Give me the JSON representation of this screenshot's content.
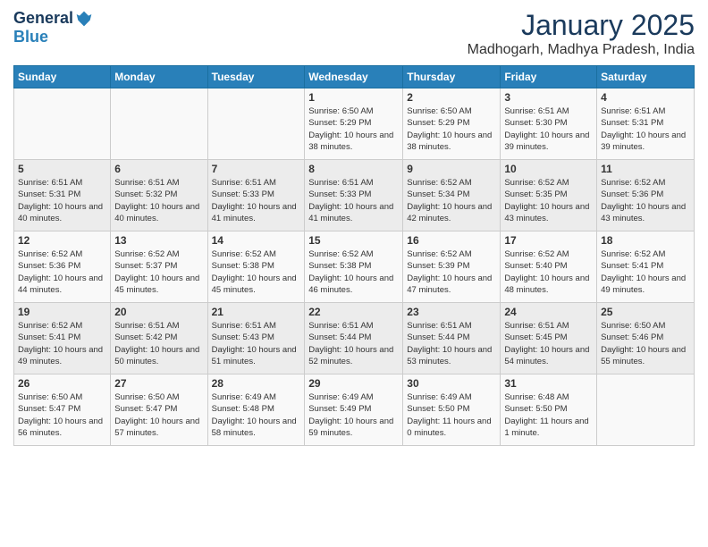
{
  "header": {
    "logo_general": "General",
    "logo_blue": "Blue",
    "month_title": "January 2025",
    "location": "Madhogarh, Madhya Pradesh, India"
  },
  "days_of_week": [
    "Sunday",
    "Monday",
    "Tuesday",
    "Wednesday",
    "Thursday",
    "Friday",
    "Saturday"
  ],
  "weeks": [
    [
      {
        "day": "",
        "sunrise": "",
        "sunset": "",
        "daylight": ""
      },
      {
        "day": "",
        "sunrise": "",
        "sunset": "",
        "daylight": ""
      },
      {
        "day": "",
        "sunrise": "",
        "sunset": "",
        "daylight": ""
      },
      {
        "day": "1",
        "sunrise": "Sunrise: 6:50 AM",
        "sunset": "Sunset: 5:29 PM",
        "daylight": "Daylight: 10 hours and 38 minutes."
      },
      {
        "day": "2",
        "sunrise": "Sunrise: 6:50 AM",
        "sunset": "Sunset: 5:29 PM",
        "daylight": "Daylight: 10 hours and 38 minutes."
      },
      {
        "day": "3",
        "sunrise": "Sunrise: 6:51 AM",
        "sunset": "Sunset: 5:30 PM",
        "daylight": "Daylight: 10 hours and 39 minutes."
      },
      {
        "day": "4",
        "sunrise": "Sunrise: 6:51 AM",
        "sunset": "Sunset: 5:31 PM",
        "daylight": "Daylight: 10 hours and 39 minutes."
      }
    ],
    [
      {
        "day": "5",
        "sunrise": "Sunrise: 6:51 AM",
        "sunset": "Sunset: 5:31 PM",
        "daylight": "Daylight: 10 hours and 40 minutes."
      },
      {
        "day": "6",
        "sunrise": "Sunrise: 6:51 AM",
        "sunset": "Sunset: 5:32 PM",
        "daylight": "Daylight: 10 hours and 40 minutes."
      },
      {
        "day": "7",
        "sunrise": "Sunrise: 6:51 AM",
        "sunset": "Sunset: 5:33 PM",
        "daylight": "Daylight: 10 hours and 41 minutes."
      },
      {
        "day": "8",
        "sunrise": "Sunrise: 6:51 AM",
        "sunset": "Sunset: 5:33 PM",
        "daylight": "Daylight: 10 hours and 41 minutes."
      },
      {
        "day": "9",
        "sunrise": "Sunrise: 6:52 AM",
        "sunset": "Sunset: 5:34 PM",
        "daylight": "Daylight: 10 hours and 42 minutes."
      },
      {
        "day": "10",
        "sunrise": "Sunrise: 6:52 AM",
        "sunset": "Sunset: 5:35 PM",
        "daylight": "Daylight: 10 hours and 43 minutes."
      },
      {
        "day": "11",
        "sunrise": "Sunrise: 6:52 AM",
        "sunset": "Sunset: 5:36 PM",
        "daylight": "Daylight: 10 hours and 43 minutes."
      }
    ],
    [
      {
        "day": "12",
        "sunrise": "Sunrise: 6:52 AM",
        "sunset": "Sunset: 5:36 PM",
        "daylight": "Daylight: 10 hours and 44 minutes."
      },
      {
        "day": "13",
        "sunrise": "Sunrise: 6:52 AM",
        "sunset": "Sunset: 5:37 PM",
        "daylight": "Daylight: 10 hours and 45 minutes."
      },
      {
        "day": "14",
        "sunrise": "Sunrise: 6:52 AM",
        "sunset": "Sunset: 5:38 PM",
        "daylight": "Daylight: 10 hours and 45 minutes."
      },
      {
        "day": "15",
        "sunrise": "Sunrise: 6:52 AM",
        "sunset": "Sunset: 5:38 PM",
        "daylight": "Daylight: 10 hours and 46 minutes."
      },
      {
        "day": "16",
        "sunrise": "Sunrise: 6:52 AM",
        "sunset": "Sunset: 5:39 PM",
        "daylight": "Daylight: 10 hours and 47 minutes."
      },
      {
        "day": "17",
        "sunrise": "Sunrise: 6:52 AM",
        "sunset": "Sunset: 5:40 PM",
        "daylight": "Daylight: 10 hours and 48 minutes."
      },
      {
        "day": "18",
        "sunrise": "Sunrise: 6:52 AM",
        "sunset": "Sunset: 5:41 PM",
        "daylight": "Daylight: 10 hours and 49 minutes."
      }
    ],
    [
      {
        "day": "19",
        "sunrise": "Sunrise: 6:52 AM",
        "sunset": "Sunset: 5:41 PM",
        "daylight": "Daylight: 10 hours and 49 minutes."
      },
      {
        "day": "20",
        "sunrise": "Sunrise: 6:51 AM",
        "sunset": "Sunset: 5:42 PM",
        "daylight": "Daylight: 10 hours and 50 minutes."
      },
      {
        "day": "21",
        "sunrise": "Sunrise: 6:51 AM",
        "sunset": "Sunset: 5:43 PM",
        "daylight": "Daylight: 10 hours and 51 minutes."
      },
      {
        "day": "22",
        "sunrise": "Sunrise: 6:51 AM",
        "sunset": "Sunset: 5:44 PM",
        "daylight": "Daylight: 10 hours and 52 minutes."
      },
      {
        "day": "23",
        "sunrise": "Sunrise: 6:51 AM",
        "sunset": "Sunset: 5:44 PM",
        "daylight": "Daylight: 10 hours and 53 minutes."
      },
      {
        "day": "24",
        "sunrise": "Sunrise: 6:51 AM",
        "sunset": "Sunset: 5:45 PM",
        "daylight": "Daylight: 10 hours and 54 minutes."
      },
      {
        "day": "25",
        "sunrise": "Sunrise: 6:50 AM",
        "sunset": "Sunset: 5:46 PM",
        "daylight": "Daylight: 10 hours and 55 minutes."
      }
    ],
    [
      {
        "day": "26",
        "sunrise": "Sunrise: 6:50 AM",
        "sunset": "Sunset: 5:47 PM",
        "daylight": "Daylight: 10 hours and 56 minutes."
      },
      {
        "day": "27",
        "sunrise": "Sunrise: 6:50 AM",
        "sunset": "Sunset: 5:47 PM",
        "daylight": "Daylight: 10 hours and 57 minutes."
      },
      {
        "day": "28",
        "sunrise": "Sunrise: 6:49 AM",
        "sunset": "Sunset: 5:48 PM",
        "daylight": "Daylight: 10 hours and 58 minutes."
      },
      {
        "day": "29",
        "sunrise": "Sunrise: 6:49 AM",
        "sunset": "Sunset: 5:49 PM",
        "daylight": "Daylight: 10 hours and 59 minutes."
      },
      {
        "day": "30",
        "sunrise": "Sunrise: 6:49 AM",
        "sunset": "Sunset: 5:50 PM",
        "daylight": "Daylight: 11 hours and 0 minutes."
      },
      {
        "day": "31",
        "sunrise": "Sunrise: 6:48 AM",
        "sunset": "Sunset: 5:50 PM",
        "daylight": "Daylight: 11 hours and 1 minute."
      },
      {
        "day": "",
        "sunrise": "",
        "sunset": "",
        "daylight": ""
      }
    ]
  ]
}
